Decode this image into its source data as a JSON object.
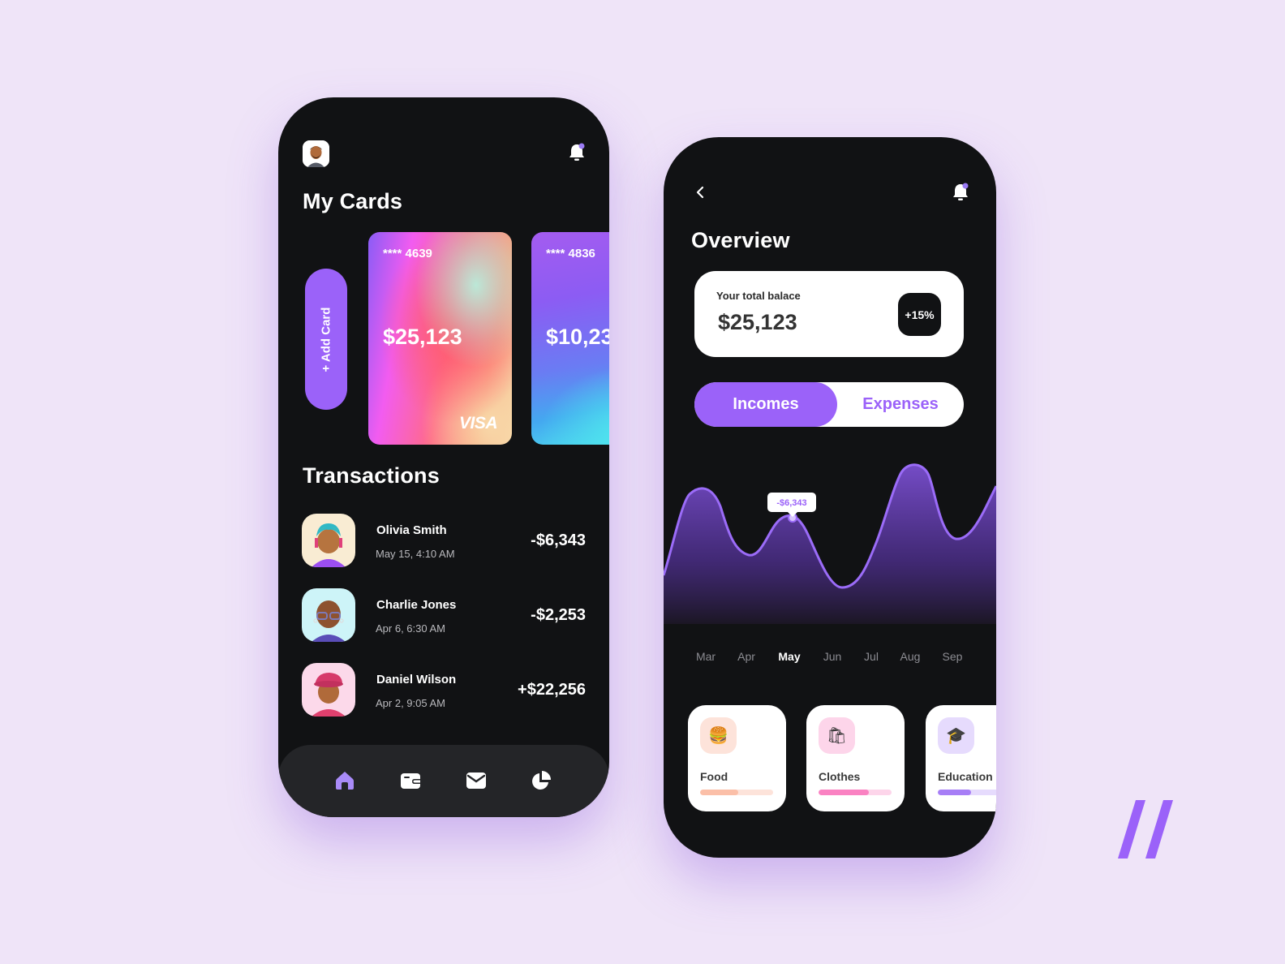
{
  "phone_left": {
    "header": {
      "avatar": "user-avatar",
      "notification_icon": "bell-icon"
    },
    "title": "My Cards",
    "add_card_label": "+ Add Card",
    "cards": [
      {
        "number": "**** 4639",
        "balance": "$25,123",
        "brand": "VISA"
      },
      {
        "number": "**** 4836",
        "balance": "$10,23"
      }
    ],
    "transactions_title": "Transactions",
    "transactions": [
      {
        "name": "Olivia Smith",
        "date": "May 15, 4:10 AM",
        "amount": "-$6,343",
        "avatar_bg": "#f9ecd3"
      },
      {
        "name": "Charlie Jones",
        "date": "Apr  6, 6:30 AM",
        "amount": "-$2,253",
        "avatar_bg": "#cdf4f8"
      },
      {
        "name": "Daniel Wilson",
        "date": "Apr  2, 9:05 AM",
        "amount": "+$22,256",
        "avatar_bg": "#fcd9ea"
      }
    ],
    "nav": [
      {
        "icon": "home-icon",
        "active": true
      },
      {
        "icon": "wallet-icon",
        "active": false
      },
      {
        "icon": "mail-icon",
        "active": false
      },
      {
        "icon": "pie-chart-icon",
        "active": false
      }
    ]
  },
  "phone_right": {
    "back_icon": "chevron-left-icon",
    "title": "Overview",
    "balance": {
      "label": "Your total balace",
      "amount": "$25,123",
      "change": "+15%"
    },
    "tabs": [
      {
        "label": "Incomes",
        "active": true
      },
      {
        "label": "Expenses",
        "active": false
      }
    ],
    "chart": {
      "months": [
        "Mar",
        "Apr",
        "May",
        "Jun",
        "Jul",
        "Aug",
        "Sep"
      ],
      "active_month": "May",
      "tooltip": "-$6,343"
    },
    "categories": [
      {
        "label": "Food",
        "icon": "🍔",
        "icon_name": "burger-icon",
        "icon_bg": "#fde3da",
        "color": "#fbbfa8",
        "track": "#fde3da",
        "progress": 0.52
      },
      {
        "label": "Clothes",
        "icon": "🛍",
        "icon_name": "shopping-bags-icon",
        "icon_bg": "#fdd5ea",
        "color": "#fa82c2",
        "track": "#fdd5ea",
        "progress": 0.69
      },
      {
        "label": "Education",
        "icon": "🎓",
        "icon_name": "graduation-cap-icon",
        "icon_bg": "#e6dbfd",
        "color": "#a77ef6",
        "track": "#e6dbfd",
        "progress": 0.45
      }
    ]
  },
  "colors": {
    "accent": "#9b62f9",
    "background": "#efe4f8",
    "phone": "#111214"
  }
}
